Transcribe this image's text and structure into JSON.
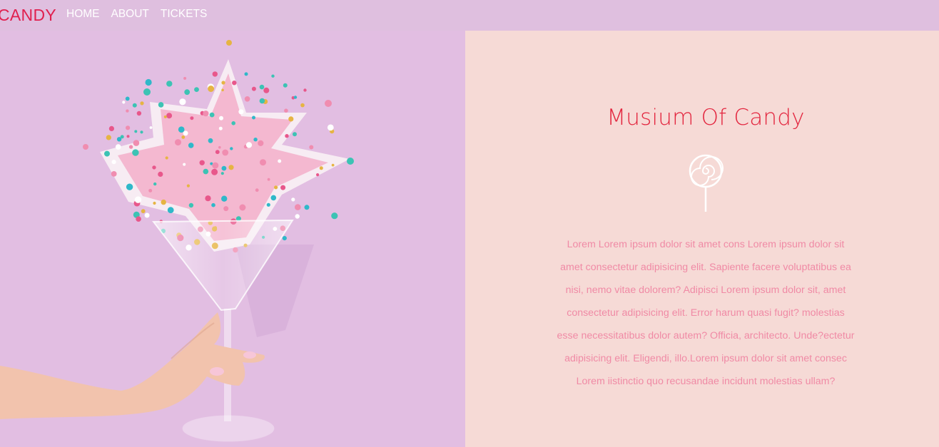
{
  "nav": {
    "brand": "CANDY",
    "links": [
      "HOME",
      "ABOUT",
      "TICKETS"
    ]
  },
  "hero": {
    "image_alt": "hand holding martini glass overflowing with sprinkles",
    "title": "Musium Of Candy",
    "icon": "lollipop-icon",
    "paragraph": "Lorem Lorem ipsum dolor sit amet cons Lorem ipsum dolor sit amet consectetur adipisicing elit. Sapiente facere voluptatibus ea nisi, nemo vitae dolorem? Adipisci Lorem ipsum dolor sit, amet consectetur adipisicing elit. Error harum quasi fugit? molestias esse necessitatibus dolor autem? Officia, architecto. Unde?ectetur adipisicing elit. Eligendi, illo.Lorem ipsum dolor sit amet consec Lorem iistinctio quo recusandae incidunt molestias ullam?"
  },
  "colors": {
    "nav_bg": "#dfbfdf",
    "brand": "#e0204f",
    "left_bg": "#e2bee2",
    "right_bg": "#f6dad6",
    "title": "#e3263f",
    "body_text": "#f08aa5"
  }
}
